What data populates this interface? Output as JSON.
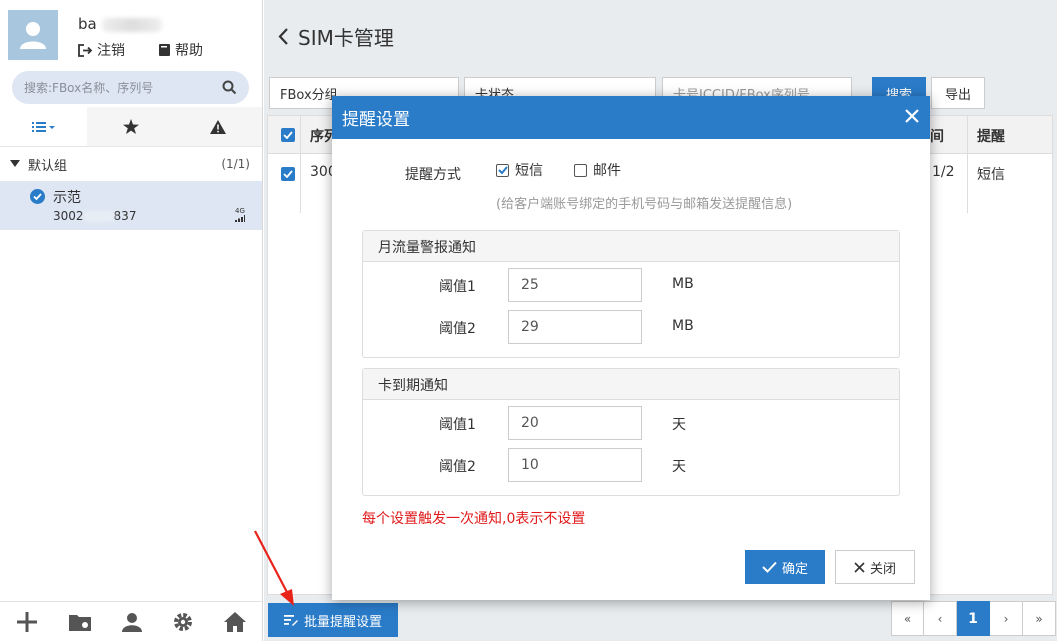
{
  "sidebar": {
    "user_name": "ba",
    "logout_label": "注销",
    "help_label": "帮助",
    "search_placeholder": "搜索:FBox名称、序列号",
    "group": {
      "name": "默认组",
      "count": "(1/1)"
    },
    "device": {
      "name": "示范",
      "serial_prefix": "3002",
      "serial_suffix": "837",
      "signal": "4G"
    }
  },
  "main": {
    "title": "SIM卡管理",
    "filter_group": "FBox分组",
    "filter_status": "卡状态",
    "filter_search_placeholder": "卡号ICCID/FBox序列号",
    "search_label": "搜索",
    "export_label": "导出",
    "table": {
      "headers": [
        "序列",
        "间",
        "提醒"
      ],
      "row": {
        "serial": "300",
        "date_part": "1/2",
        "remind": "短信"
      }
    },
    "batch_label": "批量提醒设置",
    "pager": [
      "«",
      "‹",
      "1",
      "›",
      "»"
    ]
  },
  "modal": {
    "title": "提醒设置",
    "notify_label": "提醒方式",
    "sms_label": "短信",
    "email_label": "邮件",
    "sms_checked": true,
    "email_checked": false,
    "hint": "(给客户端账号绑定的手机号码与邮箱发送提醒信息)",
    "traffic": {
      "title": "月流量警报通知",
      "t1_label": "阈值1",
      "t1_value": "25",
      "t1_unit": "MB",
      "t2_label": "阈值2",
      "t2_value": "29",
      "t2_unit": "MB"
    },
    "expire": {
      "title": "卡到期通知",
      "t1_label": "阈值1",
      "t1_value": "20",
      "t1_unit": "天",
      "t2_label": "阈值2",
      "t2_value": "10",
      "t2_unit": "天"
    },
    "warning": "每个设置触发一次通知,0表示不设置",
    "ok_label": "确定",
    "close_label": "关闭"
  },
  "colors": {
    "primary": "#2a7bc8",
    "warning": "#e01b1b",
    "arrow": "#e8231a"
  }
}
